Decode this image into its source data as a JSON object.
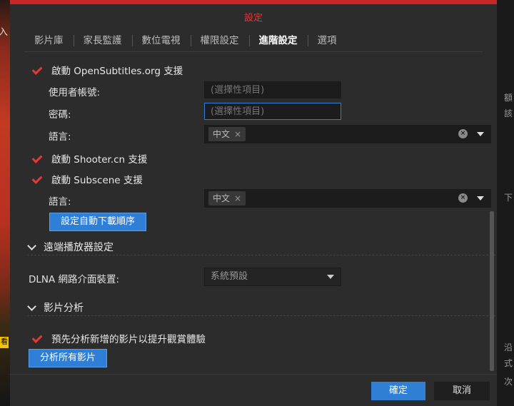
{
  "background": {
    "left_mark": "入",
    "left_tag": "看",
    "right_marks": [
      "額",
      "該",
      "下",
      "沿",
      "式",
      "次"
    ]
  },
  "dialog": {
    "title": "設定"
  },
  "tabs": [
    {
      "label": "影片庫"
    },
    {
      "label": "家長監護"
    },
    {
      "label": "數位電視"
    },
    {
      "label": "權限設定"
    },
    {
      "label": "進階設定",
      "active": true
    },
    {
      "label": "選項"
    }
  ],
  "opensubtitles": {
    "enable_label": "啟動 OpenSubtitles.org 支援",
    "username_label": "使用者帳號:",
    "username_placeholder": "(選擇性項目)",
    "password_label": "密碼:",
    "password_placeholder": "(選擇性項目)",
    "language_label": "語言:",
    "language_value": "中文"
  },
  "shooter": {
    "enable_label": "啟動 Shooter.cn 支援"
  },
  "subscene": {
    "enable_label": "啟動 Subscene 支援",
    "language_label": "語言:",
    "language_value": "中文"
  },
  "auto_download_button": "設定自動下載順序",
  "remote_player": {
    "section_title": "遠端播放器設定",
    "dlna_label": "DLNA 網路介面裝置:",
    "dlna_value": "系統預設"
  },
  "video_analysis": {
    "section_title": "影片分析",
    "preanalyze_label": "預先分析新增的影片以提升觀賞體驗",
    "analyze_all_button": "分析所有影片"
  },
  "footer": {
    "ok": "確定",
    "cancel": "取消"
  },
  "colors": {
    "accent_red": "#c62828",
    "primary_blue": "#2f7fd6",
    "check_red": "#e53935"
  }
}
